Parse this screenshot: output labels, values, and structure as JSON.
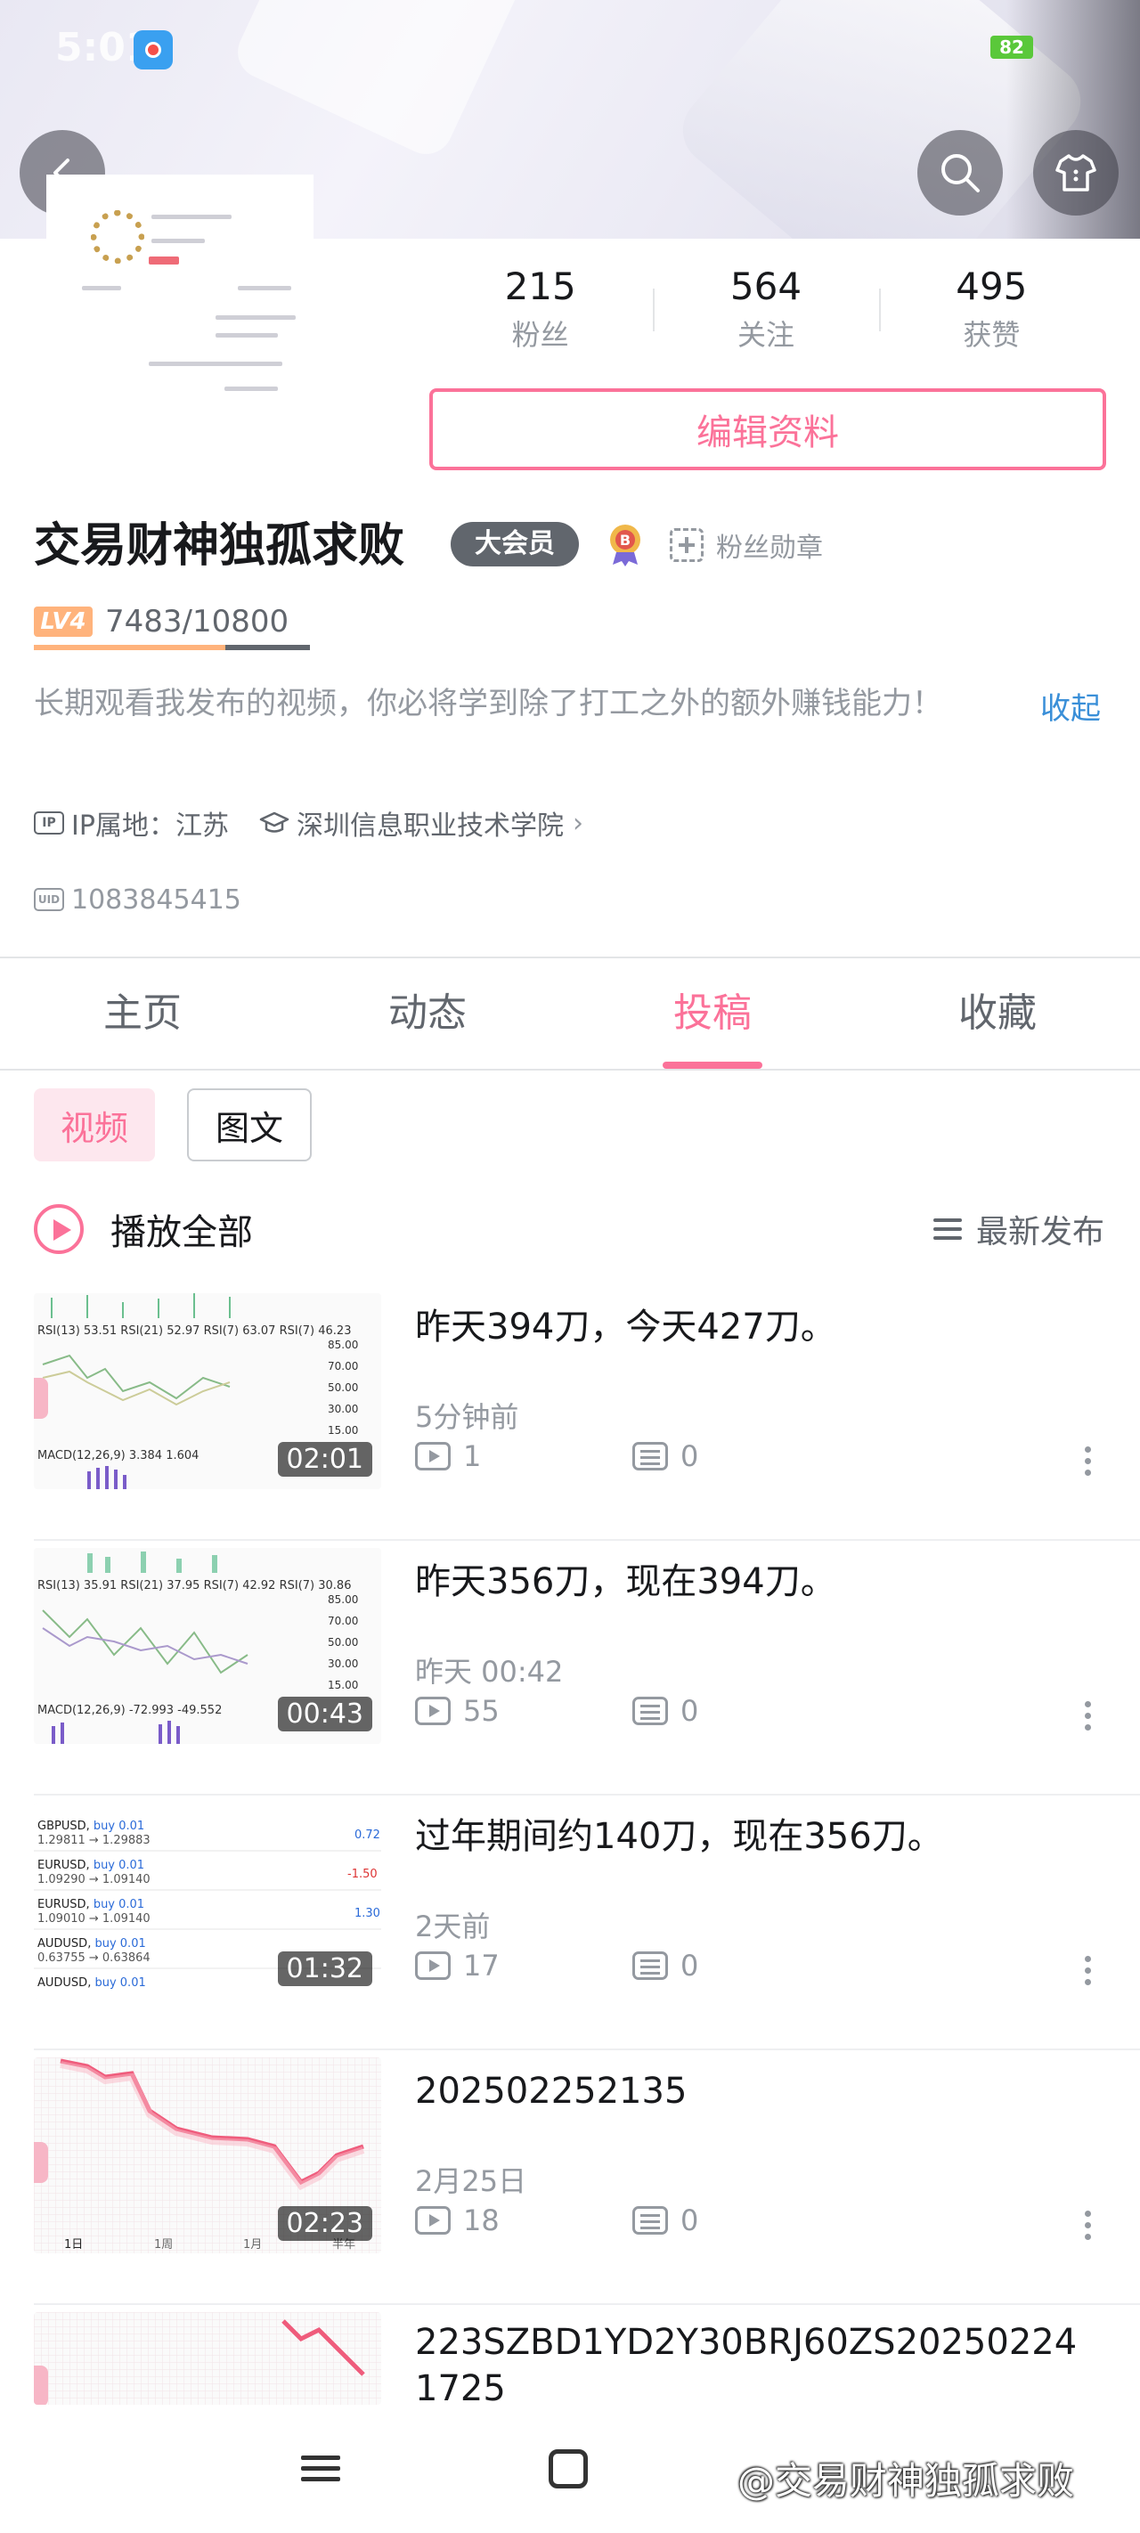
{
  "status_bar": {
    "time": "5:01",
    "battery": "82"
  },
  "profile": {
    "stats": [
      {
        "value": "215",
        "label": "粉丝"
      },
      {
        "value": "564",
        "label": "关注"
      },
      {
        "value": "495",
        "label": "获赞"
      }
    ],
    "edit_button": "编辑资料",
    "name": "交易财神独孤求败",
    "vip_badge": "大会员",
    "fans_medal": "粉丝勋章",
    "level_tag": "LV4",
    "level_progress_text": "7483/10800",
    "level_progress_fraction": 0.693,
    "bio": "长期观看我发布的视频，你必将学到除了打工之外的额外赚钱能力！",
    "collapse_label": "收起",
    "ip_label": "IP属地：江苏",
    "school": "深圳信息职业技术学院",
    "uid": "1083845415"
  },
  "tabs": [
    {
      "label": "主页",
      "active": false
    },
    {
      "label": "动态",
      "active": false
    },
    {
      "label": "投稿",
      "active": true
    },
    {
      "label": "收藏",
      "active": false
    }
  ],
  "filters": {
    "video": "视频",
    "image_text": "图文"
  },
  "list_header": {
    "play_all": "播放全部",
    "sort": "最新发布"
  },
  "videos": [
    {
      "title": "昨天394刀，今天427刀。",
      "time": "5分钟前",
      "plays": "1",
      "comments": "0",
      "duration": "02:01"
    },
    {
      "title": "昨天356刀，现在394刀。",
      "time": "昨天 00:42",
      "plays": "55",
      "comments": "0",
      "duration": "00:43"
    },
    {
      "title": "过年期间约140刀，现在356刀。",
      "time": "2天前",
      "plays": "17",
      "comments": "0",
      "duration": "01:32"
    },
    {
      "title": "202502252135",
      "time": "2月25日",
      "plays": "18",
      "comments": "0",
      "duration": "02:23"
    },
    {
      "title": "223SZBD1YD2Y30BRJ60ZS202502241725",
      "time": "",
      "plays": "",
      "comments": "",
      "duration": ""
    }
  ],
  "watermark": "@交易财神独孤求败",
  "colors": {
    "accent": "#fb7299",
    "link": "#3a8fd8",
    "level": "#ffb37c"
  }
}
